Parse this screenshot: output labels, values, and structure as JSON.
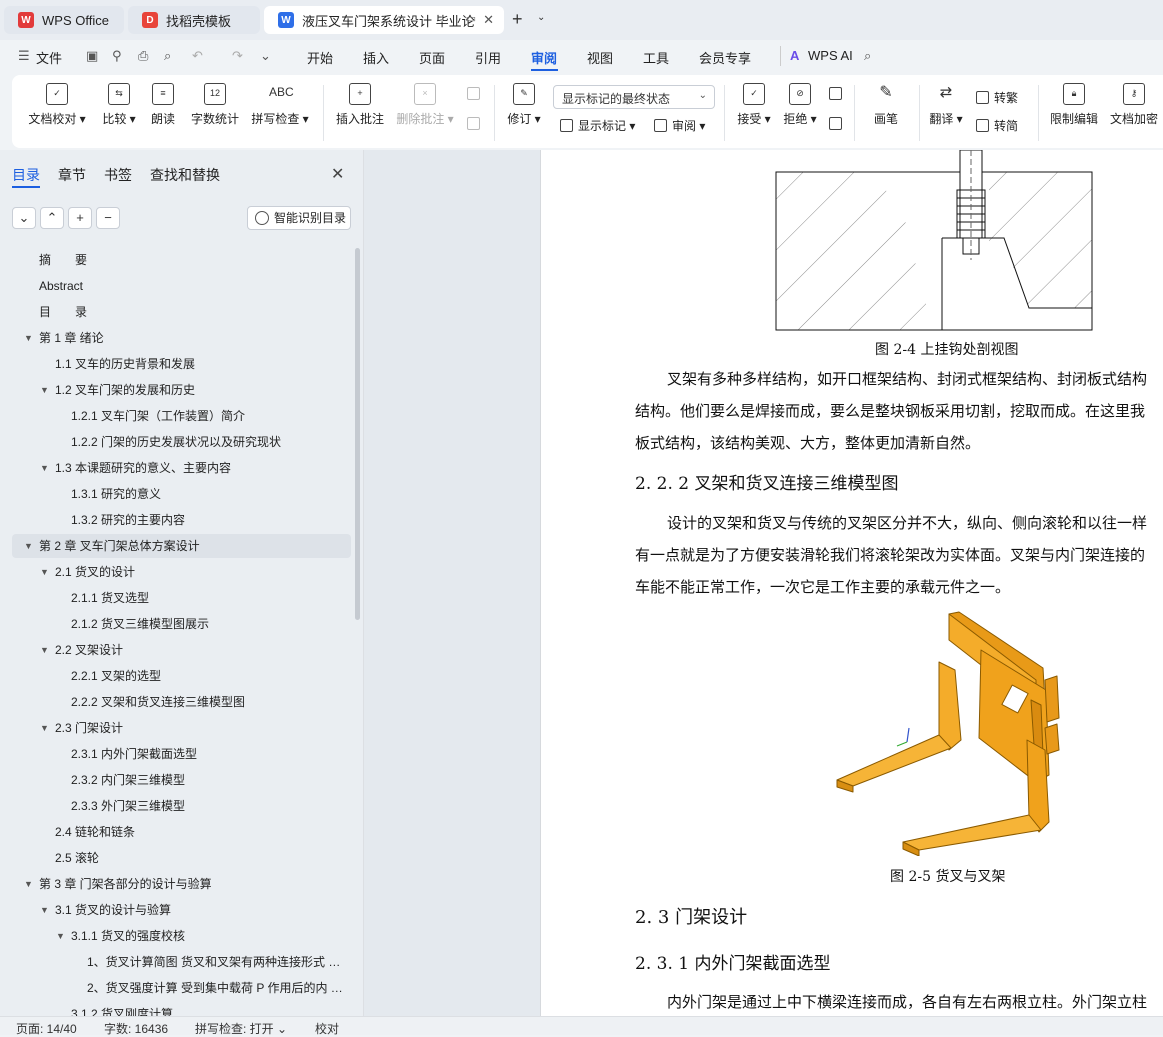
{
  "tabs": [
    {
      "label": "WPS Office",
      "icon": "wps-logo-icon"
    },
    {
      "label": "找稻壳模板",
      "icon": "docer-icon"
    },
    {
      "label": "液压叉车门架系统设计 毕业论",
      "icon": "word-doc-icon"
    }
  ],
  "menu": {
    "file": "文件",
    "items": [
      "开始",
      "插入",
      "页面",
      "引用",
      "审阅",
      "视图",
      "工具",
      "会员专享"
    ],
    "active": "审阅",
    "wps_ai": "WPS AI"
  },
  "ribbon": {
    "doc_check": "文档校对",
    "compare": "比较",
    "read_aloud": "朗读",
    "word_count": "字数统计",
    "spell_check": "拼写检查",
    "insert_comment": "插入批注",
    "delete_comment": "删除批注",
    "revise": "修订",
    "markup_select": "显示标记的最终状态",
    "show_markup": "显示标记",
    "review": "审阅",
    "accept": "接受",
    "reject": "拒绝",
    "ink": "画笔",
    "translate": "翻译",
    "to_traditional": "转繁",
    "to_simplified": "转简",
    "restrict_edit": "限制编辑",
    "doc_encrypt": "文档加密",
    "word_count_icon_text": "12",
    "spell_icon_text": "ABC"
  },
  "panel": {
    "tabs": [
      "目录",
      "章节",
      "书签",
      "查找和替换"
    ],
    "smart_toc": "智能识别目录",
    "toc": [
      {
        "text": "摘　　要",
        "level": 0,
        "caret": false
      },
      {
        "text": "Abstract",
        "level": 0,
        "caret": false
      },
      {
        "text": "目　　录",
        "level": 0,
        "caret": false
      },
      {
        "text": "第 1 章  绪论",
        "level": 0,
        "caret": true
      },
      {
        "text": "1.1  叉车的历史背景和发展",
        "level": 1,
        "caret": false
      },
      {
        "text": "1.2  叉车门架的发展和历史",
        "level": 1,
        "caret": true
      },
      {
        "text": "1.2.1  叉车门架（工作装置）简介",
        "level": 2,
        "caret": false
      },
      {
        "text": "1.2.2  门架的历史发展状况以及研究现状",
        "level": 2,
        "caret": false
      },
      {
        "text": "1.3  本课题研究的意义、主要内容",
        "level": 1,
        "caret": true
      },
      {
        "text": "1.3.1  研究的意义",
        "level": 2,
        "caret": false
      },
      {
        "text": "1.3.2  研究的主要内容",
        "level": 2,
        "caret": false
      },
      {
        "text": "第 2 章  叉车门架总体方案设计",
        "level": 0,
        "caret": true,
        "selected": true
      },
      {
        "text": "2.1  货叉的设计",
        "level": 1,
        "caret": true
      },
      {
        "text": "2.1.1  货叉选型",
        "level": 2,
        "caret": false
      },
      {
        "text": "2.1.2  货叉三维模型图展示",
        "level": 2,
        "caret": false
      },
      {
        "text": "2.2  叉架设计",
        "level": 1,
        "caret": true
      },
      {
        "text": "2.2.1  叉架的选型",
        "level": 2,
        "caret": false
      },
      {
        "text": "2.2.2  叉架和货叉连接三维模型图",
        "level": 2,
        "caret": false
      },
      {
        "text": "2.3  门架设计",
        "level": 1,
        "caret": true
      },
      {
        "text": "2.3.1  内外门架截面选型",
        "level": 2,
        "caret": false
      },
      {
        "text": "2.3.2  内门架三维模型",
        "level": 2,
        "caret": false
      },
      {
        "text": "2.3.3  外门架三维模型",
        "level": 2,
        "caret": false
      },
      {
        "text": "2.4  链轮和链条",
        "level": 1,
        "caret": false
      },
      {
        "text": "2.5  滚轮",
        "level": 1,
        "caret": false
      },
      {
        "text": "第 3 章  门架各部分的设计与验算",
        "level": 0,
        "caret": true
      },
      {
        "text": "3.1  货叉的设计与验算",
        "level": 1,
        "caret": true
      },
      {
        "text": "3.1.1  货叉的强度校核",
        "level": 2,
        "caret": true
      },
      {
        "text": "1、货叉计算简图  货叉和叉架有两种连接形式 …",
        "level": 3,
        "caret": false
      },
      {
        "text": "2、货叉强度计算  受到集中载荷 P 作用后的内 …",
        "level": 3,
        "caret": false
      },
      {
        "text": "3.1.2  货叉刚度计算",
        "level": 2,
        "caret": false
      }
    ]
  },
  "document": {
    "fig24_caption": "图 2-4  上挂钩处剖视图",
    "para1": [
      "叉架有多种多样结构，如开口框架结构、封闭式框架结构、封闭板式结构",
      "结构。他们要么是焊接而成，要么是整块钢板采用切割，挖取而成。在这里我",
      "板式结构，该结构美观、大方，整体更加清新自然。"
    ],
    "h222": "2. 2. 2  叉架和货叉连接三维模型图",
    "para2": [
      "设计的叉架和货叉与传统的叉架区分并不大，纵向、侧向滚轮和以往一样",
      "有一点就是为了方便安装滑轮我们将滚轮架改为实体面。叉架与内门架连接的",
      "车能不能正常工作，一次它是工作主要的承载元件之一。"
    ],
    "fig25_caption": "图 2-5  货叉与叉架",
    "h23": "2. 3  门架设计",
    "h231": "2. 3. 1  内外门架截面选型",
    "para3": "内外门架是通过上中下横梁连接而成，各自有左右两根立柱。外门架立柱"
  },
  "status": {
    "page": "页面: 14/40",
    "words": "字数: 16436",
    "spell": "拼写检查: 打开",
    "proof": "校对"
  },
  "colors": {
    "accent": "#1d5fe0",
    "model_orange": "#f0a21c"
  }
}
